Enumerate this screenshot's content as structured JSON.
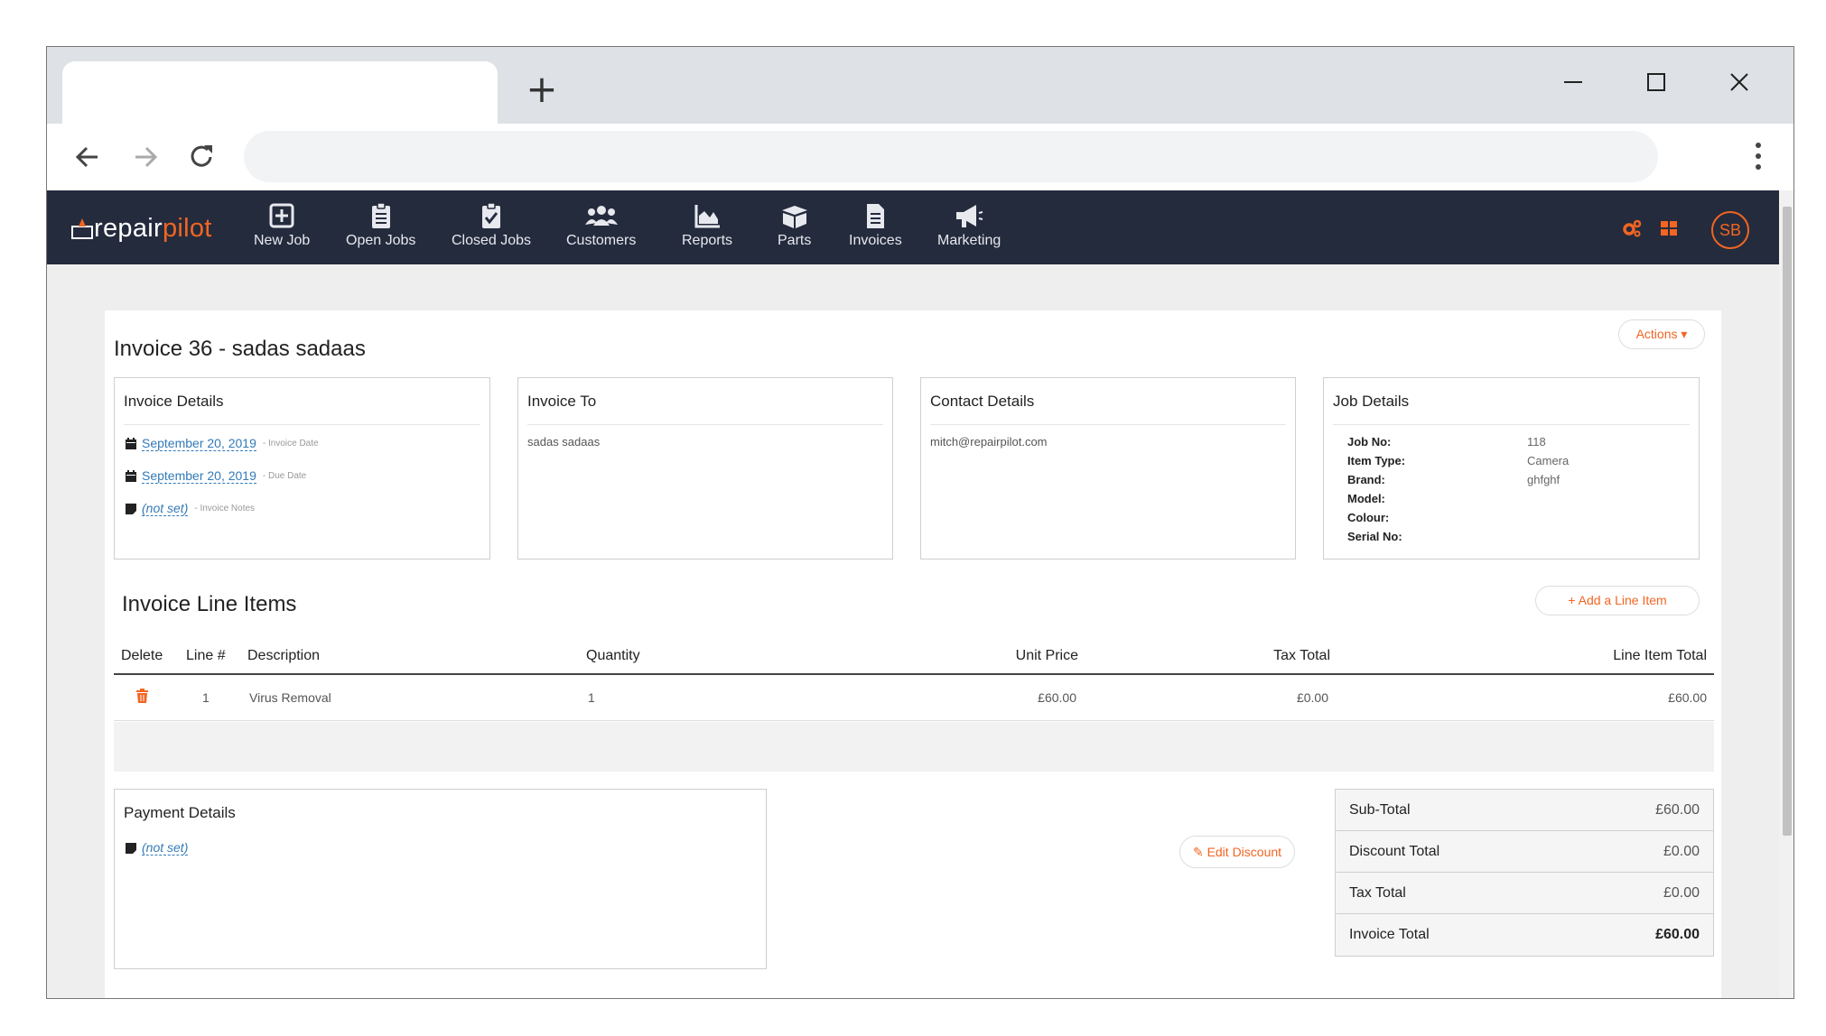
{
  "browser": {
    "new_tab_symbol": "+"
  },
  "app": {
    "logo": {
      "part1": "repair",
      "part2": "pilot"
    },
    "nav": [
      {
        "label": "New Job",
        "icon": "plus-square-icon"
      },
      {
        "label": "Open Jobs",
        "icon": "clipboard-list-icon"
      },
      {
        "label": "Closed Jobs",
        "icon": "clipboard-check-icon"
      },
      {
        "label": "Customers",
        "icon": "users-icon"
      },
      {
        "label": "Reports",
        "icon": "area-chart-icon"
      },
      {
        "label": "Parts",
        "icon": "box-open-icon"
      },
      {
        "label": "Invoices",
        "icon": "file-invoice-icon"
      },
      {
        "label": "Marketing",
        "icon": "megaphone-icon"
      }
    ],
    "avatar_initials": "SB",
    "accent_color": "#f26522",
    "nav_bg": "#242b3d"
  },
  "invoice": {
    "title": "Invoice 36 - sadas sadaas",
    "actions_label": "Actions",
    "details": {
      "heading": "Invoice Details",
      "invoice_date": "September 20, 2019",
      "invoice_date_hint": "- Invoice Date",
      "due_date": "September 20, 2019",
      "due_date_hint": "- Due Date",
      "notes": "(not set)",
      "notes_hint": "- Invoice Notes"
    },
    "invoice_to": {
      "heading": "Invoice To",
      "name": "sadas sadaas"
    },
    "contact": {
      "heading": "Contact Details",
      "email": "mitch@repairpilot.com"
    },
    "job": {
      "heading": "Job Details",
      "rows": [
        {
          "label": "Job No:",
          "value": "118"
        },
        {
          "label": "Item Type:",
          "value": "Camera"
        },
        {
          "label": "Brand:",
          "value": "ghfghf"
        },
        {
          "label": "Model:",
          "value": ""
        },
        {
          "label": "Colour:",
          "value": ""
        },
        {
          "label": "Serial No:",
          "value": ""
        }
      ]
    },
    "line_items": {
      "heading": "Invoice Line Items",
      "add_label": "Add a Line Item",
      "columns": [
        "Delete",
        "Line #",
        "Description",
        "Quantity",
        "Unit Price",
        "Tax Total",
        "Line Item Total"
      ],
      "rows": [
        {
          "line": "1",
          "description": "Virus Removal",
          "quantity": "1",
          "unit_price": "£60.00",
          "tax_total": "£0.00",
          "line_total": "£60.00"
        }
      ]
    },
    "payment": {
      "heading": "Payment Details",
      "value": "(not set)"
    },
    "edit_discount_label": "Edit Discount",
    "totals": [
      {
        "label": "Sub-Total",
        "value": "£60.00"
      },
      {
        "label": "Discount Total",
        "value": "£0.00"
      },
      {
        "label": "Tax Total",
        "value": "£0.00"
      },
      {
        "label": "Invoice Total",
        "value": "£60.00"
      }
    ]
  }
}
